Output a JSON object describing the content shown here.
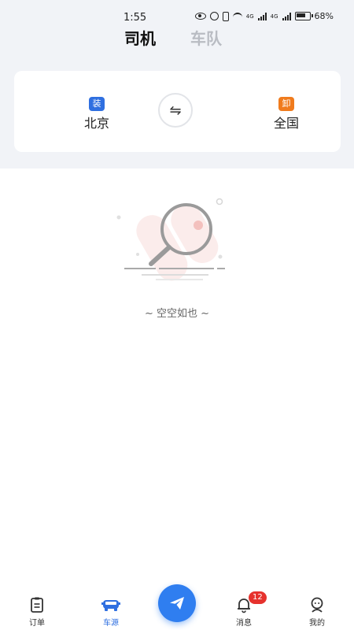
{
  "status_bar": {
    "time": "1:55",
    "battery": "68%",
    "signal_labels": [
      "4G",
      "4G"
    ]
  },
  "tabs": [
    {
      "label": "司机",
      "active": true
    },
    {
      "label": "车队",
      "active": false
    }
  ],
  "route": {
    "from": {
      "badge": "装",
      "city": "北京"
    },
    "swap_icon": "⇋",
    "to": {
      "badge": "卸",
      "city": "全国"
    }
  },
  "empty_state": {
    "message": "~ 空空如也 ~"
  },
  "bottom_nav": {
    "items": [
      {
        "label": "订单",
        "icon": "clipboard-icon"
      },
      {
        "label": "车源",
        "icon": "truck-icon",
        "active": true
      },
      {
        "label": "消息",
        "icon": "bell-icon",
        "badge": "12"
      },
      {
        "label": "我的",
        "icon": "person-icon"
      }
    ],
    "center_icon": "paper-plane-icon"
  },
  "colors": {
    "accent": "#2f7ef0",
    "badge_from": "#2f6fe0",
    "badge_to": "#f07b1d",
    "notify": "#e6322d"
  }
}
